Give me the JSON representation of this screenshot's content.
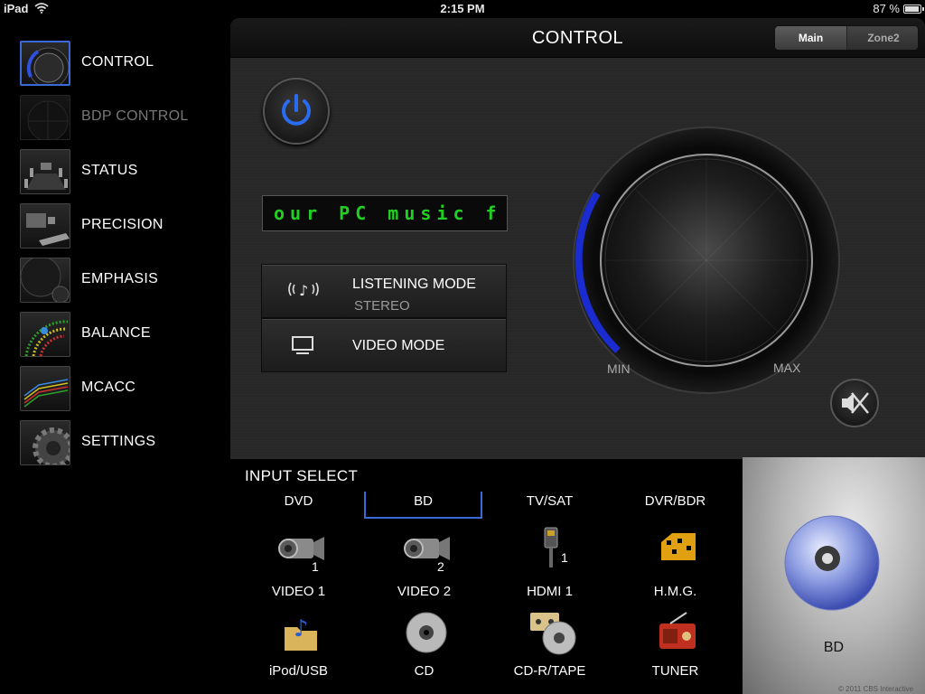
{
  "statusbar": {
    "carrier": "iPad",
    "time": "2:15 PM",
    "battery": "87 %"
  },
  "sidebar": {
    "items": [
      {
        "label": "CONTROL"
      },
      {
        "label": "BDP CONTROL"
      },
      {
        "label": "STATUS"
      },
      {
        "label": "PRECISION"
      },
      {
        "label": "EMPHASIS"
      },
      {
        "label": "BALANCE"
      },
      {
        "label": "MCACC"
      },
      {
        "label": "SETTINGS"
      }
    ]
  },
  "control": {
    "title": "CONTROL",
    "zones": [
      "Main",
      "Zone2"
    ],
    "display_text": "our PC music f",
    "listening_mode_label": "LISTENING MODE",
    "listening_mode_value": "STEREO",
    "video_mode_label": "VIDEO MODE",
    "volume_min": "MIN",
    "volume_max": "MAX"
  },
  "input_select": {
    "title": "INPUT SELECT",
    "tabs": [
      "DVD",
      "BD",
      "TV/SAT",
      "DVR/BDR"
    ],
    "selected_tab": "BD",
    "row1": [
      "VIDEO 1",
      "VIDEO 2",
      "HDMI 1",
      "H.M.G."
    ],
    "row2": [
      "iPod/USB",
      "CD",
      "CD-R/TAPE",
      "TUNER"
    ],
    "badges": {
      "video1": "1",
      "video2": "2",
      "hdmi1": "1"
    }
  },
  "preview": {
    "label": "BD"
  },
  "footer": {
    "copyright": "© 2011 CBS Interactive"
  },
  "colors": {
    "accent": "#3b6ad6",
    "display": "#20d020",
    "volume_arc": "#2030d0"
  }
}
